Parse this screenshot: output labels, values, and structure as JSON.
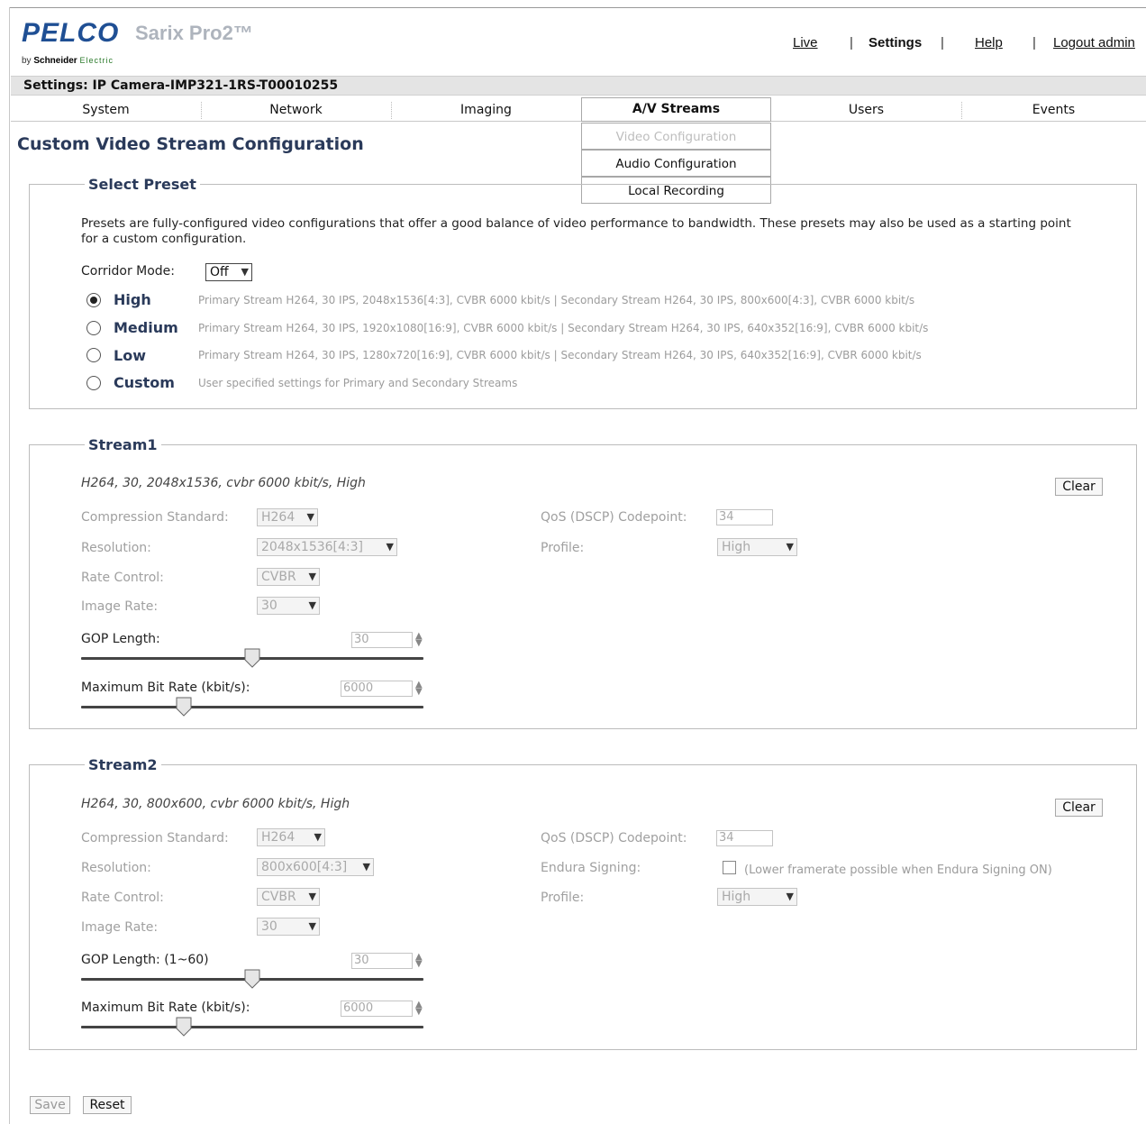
{
  "header": {
    "logo": "PELCO",
    "product": "Sarix Pro2™",
    "byline_prefix": "by ",
    "byline_brand": "Schneider",
    "byline_suffix": "Electric",
    "nav": {
      "live": "Live",
      "settings": "Settings",
      "help": "Help",
      "logout": "Logout admin",
      "separator": "|"
    }
  },
  "settings_bar": "Settings: IP Camera-IMP321-1RS-T00010255",
  "tabs": [
    "System",
    "Network",
    "Imaging",
    "A/V Streams",
    "Users",
    "Events"
  ],
  "av_menu": [
    "Video Configuration",
    "Audio Configuration",
    "Local Recording"
  ],
  "page_title": "Custom Video Stream Configuration",
  "select_preset": {
    "legend": "Select Preset",
    "description": "Presets are fully-configured video configurations that offer a good balance of video performance to bandwidth. These presets may also be used as a starting point for a custom configuration.",
    "corridor_label": "Corridor Mode:",
    "corridor_value": "Off",
    "presets": [
      {
        "label": "High",
        "selected": true,
        "desc": "Primary Stream H264, 30 IPS, 2048x1536[4:3], CVBR 6000 kbit/s | Secondary Stream H264, 30 IPS, 800x600[4:3], CVBR 6000 kbit/s"
      },
      {
        "label": "Medium",
        "selected": false,
        "desc": "Primary Stream H264, 30 IPS, 1920x1080[16:9], CVBR 6000 kbit/s | Secondary Stream H264, 30 IPS, 640x352[16:9], CVBR 6000 kbit/s"
      },
      {
        "label": "Low",
        "selected": false,
        "desc": "Primary Stream H264, 30 IPS, 1280x720[16:9], CVBR 6000 kbit/s | Secondary Stream H264, 30 IPS, 640x352[16:9], CVBR 6000 kbit/s"
      },
      {
        "label": "Custom",
        "selected": false,
        "desc": "User specified settings for Primary and Secondary Streams"
      }
    ]
  },
  "stream1": {
    "legend": "Stream1",
    "summary": "H264, 30, 2048x1536, cvbr 6000 kbit/s, High",
    "clear": "Clear",
    "compression_label": "Compression Standard:",
    "compression_value": "H264",
    "resolution_label": "Resolution:",
    "resolution_value": "2048x1536[4:3]",
    "rate_control_label": "Rate Control:",
    "rate_control_value": "CVBR",
    "image_rate_label": "Image Rate:",
    "image_rate_value": "30",
    "qos_label": "QoS (DSCP) Codepoint:",
    "qos_value": "34",
    "profile_label": "Profile:",
    "profile_value": "High",
    "gop_label": "GOP Length:",
    "gop_value": "30",
    "gop_fraction": 0.5,
    "bitrate_label": "Maximum Bit Rate (kbit/s):",
    "bitrate_value": "6000",
    "bitrate_fraction": 0.3
  },
  "stream2": {
    "legend": "Stream2",
    "summary": "H264, 30, 800x600, cvbr 6000 kbit/s, High",
    "clear": "Clear",
    "compression_label": "Compression Standard:",
    "compression_value": "H264",
    "resolution_label": "Resolution:",
    "resolution_value": "800x600[4:3]",
    "rate_control_label": "Rate Control:",
    "rate_control_value": "CVBR",
    "image_rate_label": "Image Rate:",
    "image_rate_value": "30",
    "qos_label": "QoS (DSCP) Codepoint:",
    "qos_value": "34",
    "endura_label": "Endura Signing:",
    "endura_note": "(Lower framerate possible when Endura Signing ON)",
    "profile_label": "Profile:",
    "profile_value": "High",
    "gop_label": "GOP Length: (1~60)",
    "gop_value": "30",
    "gop_fraction": 0.5,
    "bitrate_label": "Maximum Bit Rate (kbit/s):",
    "bitrate_value": "6000",
    "bitrate_fraction": 0.3
  },
  "footer": {
    "save": "Save",
    "reset": "Reset"
  }
}
